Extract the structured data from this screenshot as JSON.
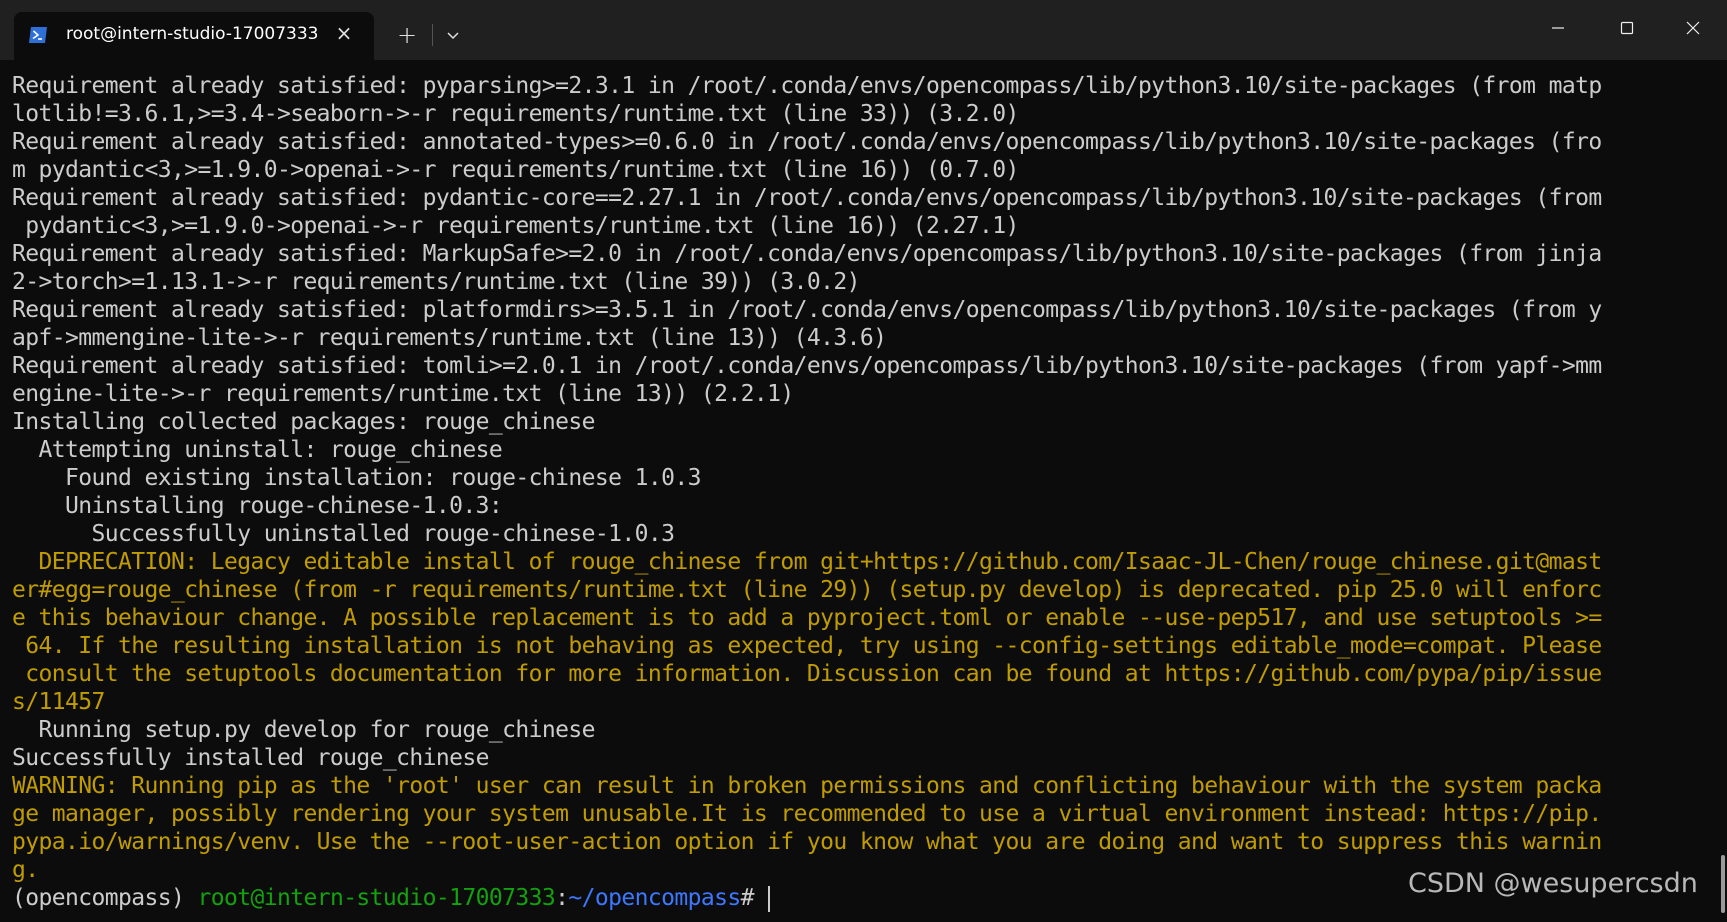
{
  "window": {
    "tab_title": "root@intern-studio-17007333",
    "tab_close_symbol": "×",
    "new_tab_symbol": "+",
    "icons": {
      "tab": "powershell-icon",
      "dropdown": "chevron-down-icon",
      "minimize": "minimize-icon",
      "maximize": "maximize-icon",
      "close": "close-icon"
    },
    "colors": {
      "titlebar": "#202020",
      "terminal_bg": "#0c0c0c",
      "text": "#cccccc",
      "warning": "#c19c00",
      "prompt_user": "#13a10e",
      "prompt_path": "#3b78ff"
    }
  },
  "terminal": {
    "lines": [
      {
        "text": "Requirement already satisfied: pyparsing>=2.3.1 in /root/.conda/envs/opencompass/lib/python3.10/site-packages (from matp",
        "style": "normal"
      },
      {
        "text": "lotlib!=3.6.1,>=3.4->seaborn->-r requirements/runtime.txt (line 33)) (3.2.0)",
        "style": "normal"
      },
      {
        "text": "Requirement already satisfied: annotated-types>=0.6.0 in /root/.conda/envs/opencompass/lib/python3.10/site-packages (fro",
        "style": "normal"
      },
      {
        "text": "m pydantic<3,>=1.9.0->openai->-r requirements/runtime.txt (line 16)) (0.7.0)",
        "style": "normal"
      },
      {
        "text": "Requirement already satisfied: pydantic-core==2.27.1 in /root/.conda/envs/opencompass/lib/python3.10/site-packages (from",
        "style": "normal"
      },
      {
        "text": " pydantic<3,>=1.9.0->openai->-r requirements/runtime.txt (line 16)) (2.27.1)",
        "style": "normal"
      },
      {
        "text": "Requirement already satisfied: MarkupSafe>=2.0 in /root/.conda/envs/opencompass/lib/python3.10/site-packages (from jinja",
        "style": "normal"
      },
      {
        "text": "2->torch>=1.13.1->-r requirements/runtime.txt (line 39)) (3.0.2)",
        "style": "normal"
      },
      {
        "text": "Requirement already satisfied: platformdirs>=3.5.1 in /root/.conda/envs/opencompass/lib/python3.10/site-packages (from y",
        "style": "normal"
      },
      {
        "text": "apf->mmengine-lite->-r requirements/runtime.txt (line 13)) (4.3.6)",
        "style": "normal"
      },
      {
        "text": "Requirement already satisfied: tomli>=2.0.1 in /root/.conda/envs/opencompass/lib/python3.10/site-packages (from yapf->mm",
        "style": "normal"
      },
      {
        "text": "engine-lite->-r requirements/runtime.txt (line 13)) (2.2.1)",
        "style": "normal"
      },
      {
        "text": "Installing collected packages: rouge_chinese",
        "style": "normal"
      },
      {
        "text": "  Attempting uninstall: rouge_chinese",
        "style": "normal"
      },
      {
        "text": "    Found existing installation: rouge-chinese 1.0.3",
        "style": "normal"
      },
      {
        "text": "    Uninstalling rouge-chinese-1.0.3:",
        "style": "normal"
      },
      {
        "text": "      Successfully uninstalled rouge-chinese-1.0.3",
        "style": "normal"
      },
      {
        "text": "  DEPRECATION: Legacy editable install of rouge_chinese from git+https://github.com/Isaac-JL-Chen/rouge_chinese.git@mast",
        "style": "warn"
      },
      {
        "text": "er#egg=rouge_chinese (from -r requirements/runtime.txt (line 29)) (setup.py develop) is deprecated. pip 25.0 will enforc",
        "style": "warn"
      },
      {
        "text": "e this behaviour change. A possible replacement is to add a pyproject.toml or enable --use-pep517, and use setuptools >=",
        "style": "warn"
      },
      {
        "text": " 64. If the resulting installation is not behaving as expected, try using --config-settings editable_mode=compat. Please",
        "style": "warn"
      },
      {
        "text": " consult the setuptools documentation for more information. Discussion can be found at https://github.com/pypa/pip/issue",
        "style": "warn"
      },
      {
        "text": "s/11457",
        "style": "warn"
      },
      {
        "text": "  Running setup.py develop for rouge_chinese",
        "style": "normal"
      },
      {
        "text": "Successfully installed rouge_chinese",
        "style": "normal"
      },
      {
        "text": "WARNING: Running pip as the 'root' user can result in broken permissions and conflicting behaviour with the system packa",
        "style": "warn"
      },
      {
        "text": "ge manager, possibly rendering your system unusable.It is recommended to use a virtual environment instead: https://pip.",
        "style": "warn"
      },
      {
        "text": "pypa.io/warnings/venv. Use the --root-user-action option if you know what you are doing and want to suppress this warnin",
        "style": "warn"
      },
      {
        "text": "g.",
        "style": "warn"
      }
    ],
    "prompt": {
      "env": "(opencompass) ",
      "user_host": "root@intern-studio-17007333",
      "colon": ":",
      "path": "~/opencompass",
      "symbol": "#"
    }
  },
  "watermark": "CSDN @wesupercsdn"
}
